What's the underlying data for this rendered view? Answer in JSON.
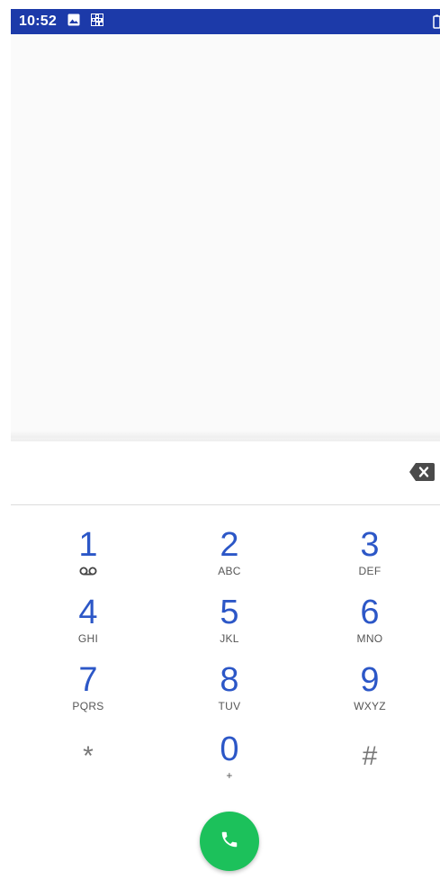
{
  "status_bar": {
    "time": "10:52",
    "icons": [
      "image-icon",
      "qr-code-icon",
      "battery-icon"
    ],
    "background": "#1c3aa9"
  },
  "dialpad": {
    "digits_value": "",
    "keys": [
      {
        "digit": "1",
        "letters": "",
        "extra_icon": "voicemail-icon"
      },
      {
        "digit": "2",
        "letters": "ABC"
      },
      {
        "digit": "3",
        "letters": "DEF"
      },
      {
        "digit": "4",
        "letters": "GHI"
      },
      {
        "digit": "5",
        "letters": "JKL"
      },
      {
        "digit": "6",
        "letters": "MNO"
      },
      {
        "digit": "7",
        "letters": "PQRS"
      },
      {
        "digit": "8",
        "letters": "TUV"
      },
      {
        "digit": "9",
        "letters": "WXYZ"
      },
      {
        "digit": "*",
        "letters": ""
      },
      {
        "digit": "0",
        "letters": "+"
      },
      {
        "digit": "#",
        "letters": ""
      }
    ],
    "backspace_icon": "backspace-icon",
    "call_icon": "phone-icon"
  },
  "colors": {
    "digit": "#2c57c7",
    "call_button": "#1cc15b",
    "symbol": "#777777"
  }
}
